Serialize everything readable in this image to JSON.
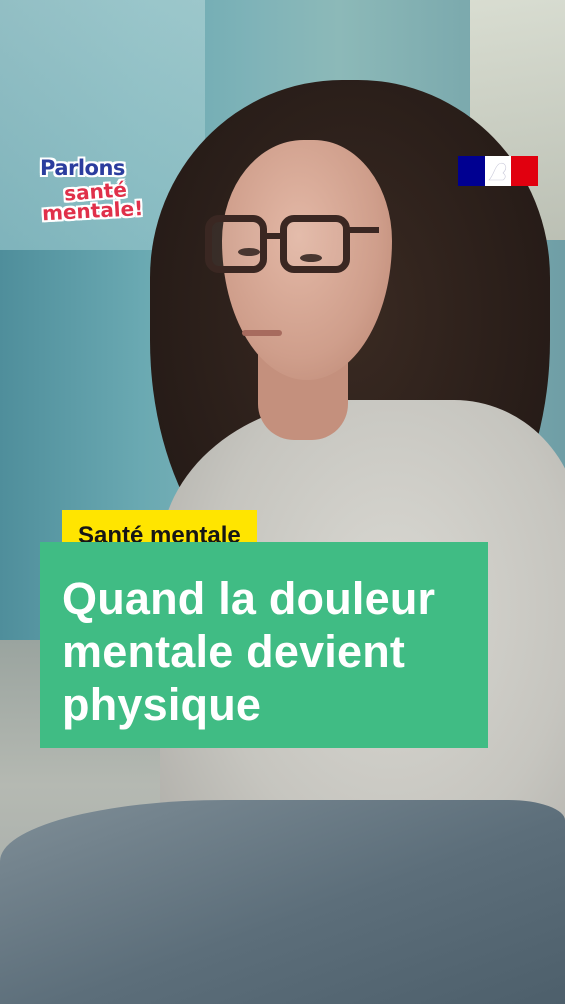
{
  "brand": {
    "campaign_logo": {
      "line1": "Parlons",
      "line2": "santé",
      "line3": "mentale!",
      "colors": {
        "primary": "#2b3d9e",
        "accent": "#e0304a"
      }
    },
    "government_logo": {
      "icon": "marianne-logo-icon",
      "colors": {
        "blue": "#000091",
        "white": "#ffffff",
        "red": "#e1000f"
      }
    }
  },
  "video": {
    "scene": "portrait-photo"
  },
  "overlay": {
    "tag": {
      "label": "Santé mentale",
      "color": "#ffe500"
    },
    "title": {
      "lines": [
        "Quand la douleur",
        "mentale devient",
        "physique"
      ],
      "color": "#40bc84"
    }
  }
}
